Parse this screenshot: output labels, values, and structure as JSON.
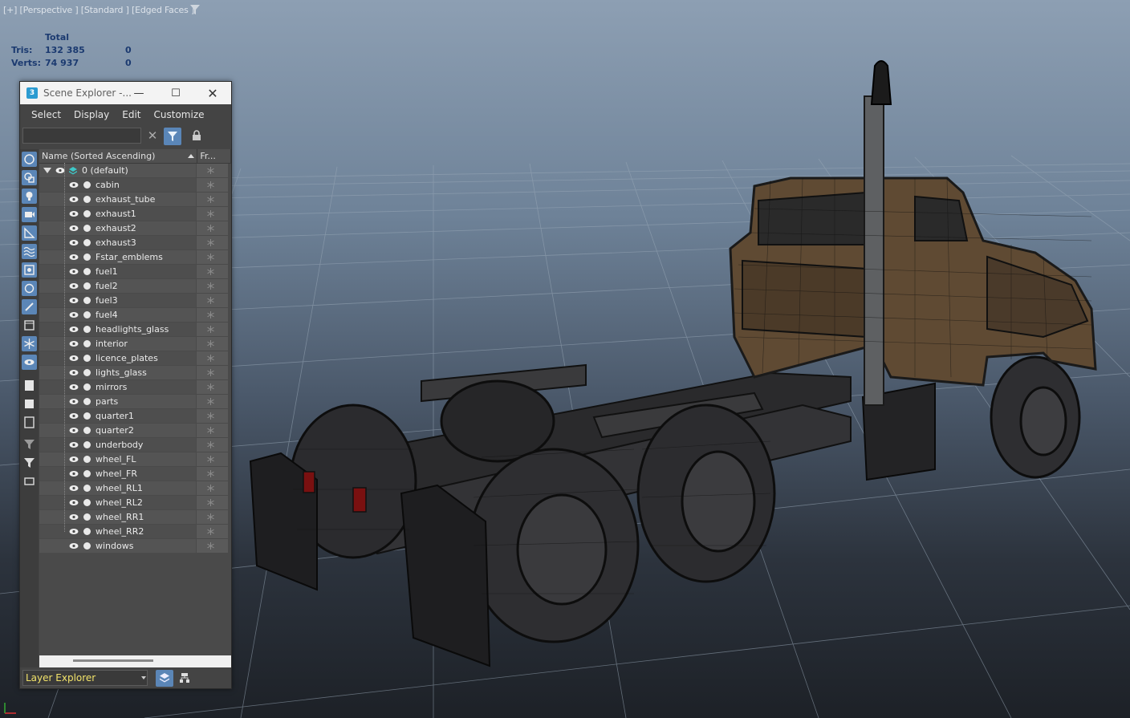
{
  "viewport": {
    "label": "[+] [Perspective ] [Standard ] [Edged Faces ]",
    "stats": {
      "header": "Total",
      "rows": [
        {
          "label": "Tris:",
          "total": "132 385",
          "selected": "0"
        },
        {
          "label": "Verts:",
          "total": "74 937",
          "selected": "0"
        }
      ]
    }
  },
  "scene_explorer": {
    "title": "Scene Explorer -...",
    "menu": [
      "Select",
      "Display",
      "Edit",
      "Customize"
    ],
    "search_value": "",
    "columns": {
      "name": "Name (Sorted Ascending)",
      "frozen": "Fr..."
    },
    "root_layer": "0 (default)",
    "objects": [
      "cabin",
      "exhaust_tube",
      "exhaust1",
      "exhaust2",
      "exhaust3",
      "Fstar_emblems",
      "fuel1",
      "fuel2",
      "fuel3",
      "fuel4",
      "headlights_glass",
      "interior",
      "licence_plates",
      "lights_glass",
      "mirrors",
      "parts",
      "quarter1",
      "quarter2",
      "underbody",
      "wheel_FL",
      "wheel_FR",
      "wheel_RL1",
      "wheel_RL2",
      "wheel_RR1",
      "wheel_RR2",
      "windows"
    ],
    "explorer_mode": "Layer Explorer",
    "app_icon": "3",
    "accent": "#5b86b7"
  }
}
